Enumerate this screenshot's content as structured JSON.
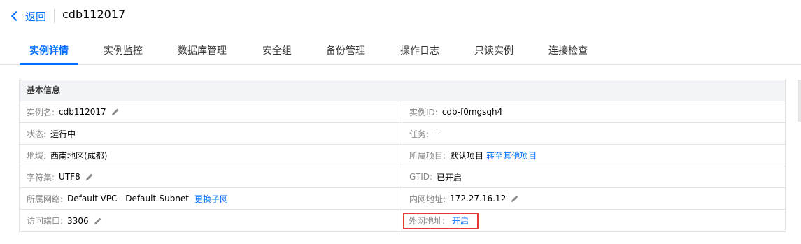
{
  "header": {
    "back_label": "返回",
    "instance_title": "cdb112017"
  },
  "tabs": [
    {
      "label": "实例详情",
      "active": true
    },
    {
      "label": "实例监控"
    },
    {
      "label": "数据库管理"
    },
    {
      "label": "安全组"
    },
    {
      "label": "备份管理"
    },
    {
      "label": "操作日志"
    },
    {
      "label": "只读实例"
    },
    {
      "label": "连接检查"
    }
  ],
  "panel": {
    "title": "基本信息",
    "rows": [
      {
        "left": {
          "label": "实例名:",
          "value": "cdb112017"
        },
        "right": {
          "label": "实例ID:",
          "value": "cdb-f0mgsqh4"
        }
      },
      {
        "left": {
          "label": "状态:",
          "value": "运行中"
        },
        "right": {
          "label": "任务:",
          "value": "--"
        }
      },
      {
        "left": {
          "label": "地域:",
          "value": "西南地区(成都)"
        },
        "right": {
          "label": "所属项目:",
          "value": "默认项目",
          "link": "转至其他项目"
        }
      },
      {
        "left": {
          "label": "字符集:",
          "value": "UTF8"
        },
        "right": {
          "label": "GTID:",
          "value": "已开启"
        }
      },
      {
        "left": {
          "label": "所属网络:",
          "value": "Default-VPC - Default-Subnet",
          "link": "更换子网"
        },
        "right": {
          "label": "内网地址:",
          "value": "172.27.16.12"
        }
      },
      {
        "left": {
          "label": "访问端口:",
          "value": "3306"
        },
        "right": {
          "label": "外网地址:",
          "link": "开启"
        }
      }
    ]
  },
  "colors": {
    "accent": "#006eff",
    "highlight_border": "#e53935"
  }
}
